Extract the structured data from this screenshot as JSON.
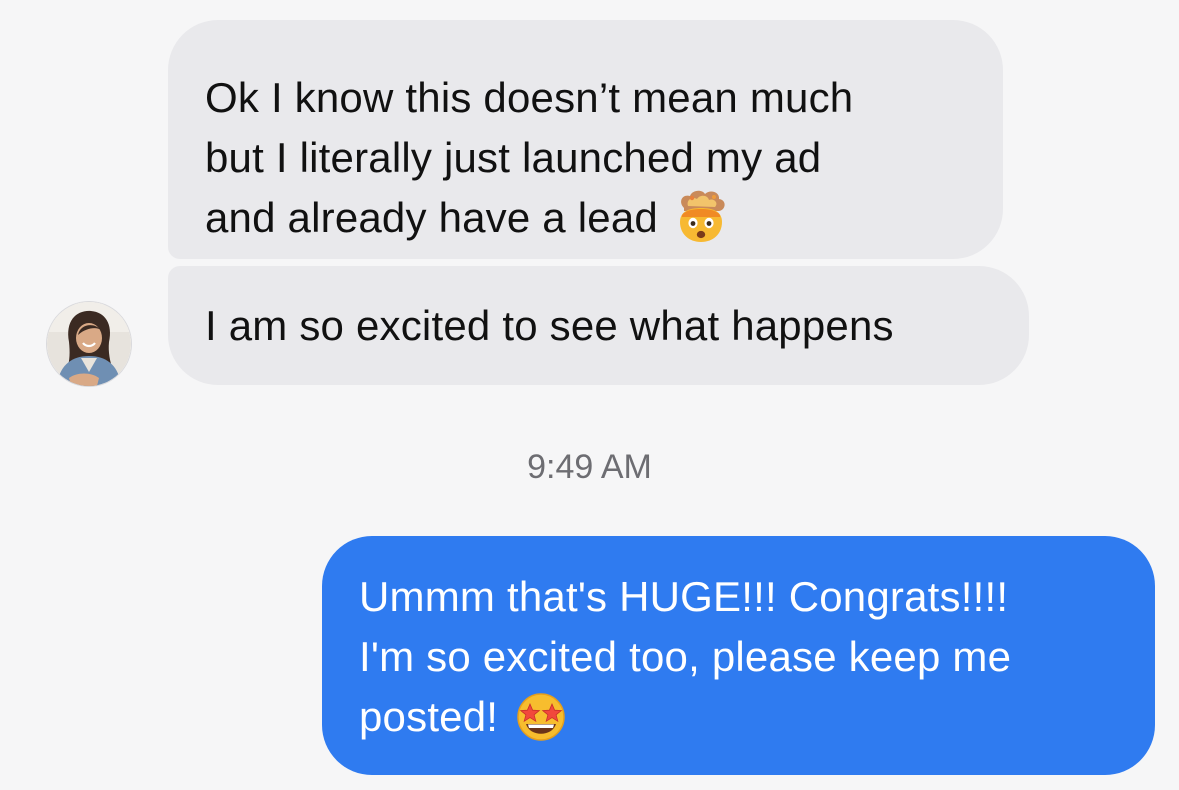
{
  "conversation": {
    "incoming": {
      "message_1": {
        "lines": [
          "Ok I know this doesn’t mean much",
          "but I literally just launched my ad",
          "and already have a lead"
        ],
        "emoji": "exploding-head-icon"
      },
      "message_2": {
        "text": "I am so excited to see what happens"
      }
    },
    "timestamp": "9:49 AM",
    "outgoing": {
      "message_3": {
        "lines": [
          "Ummm that's HUGE!!! Congrats!!!!",
          "I'm so excited too, please keep me",
          "posted!"
        ],
        "emoji": "star-struck-icon"
      }
    }
  },
  "colors": {
    "incoming_bubble": "#e9e9ec",
    "outgoing_bubble": "#2f7bf0",
    "background": "#f6f6f7",
    "timestamp_text": "#6d6d72"
  }
}
